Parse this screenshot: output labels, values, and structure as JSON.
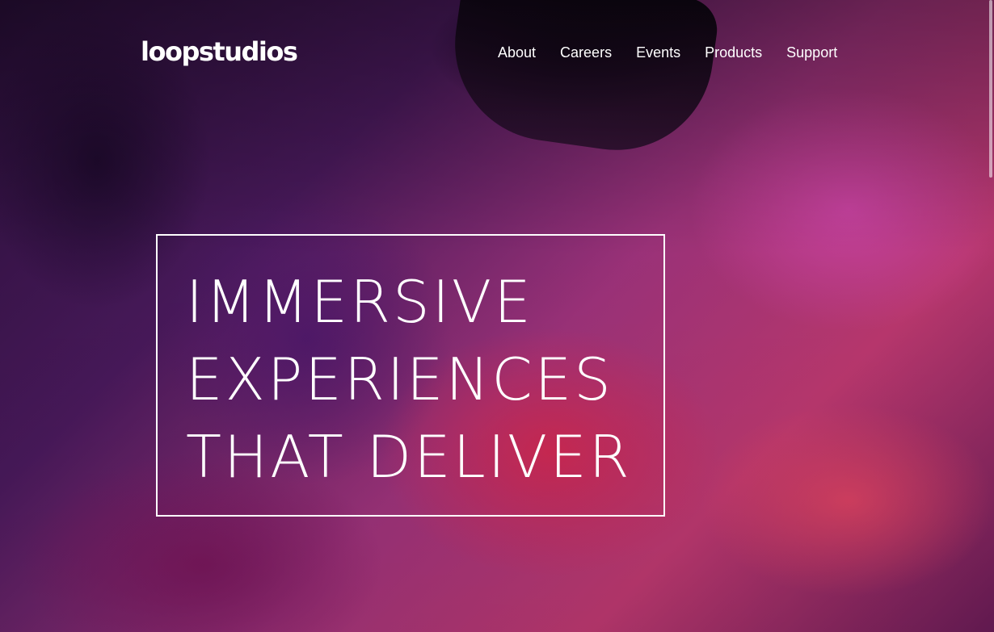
{
  "header": {
    "logo": "loopstudios",
    "nav": [
      {
        "label": "About"
      },
      {
        "label": "Careers"
      },
      {
        "label": "Events"
      },
      {
        "label": "Products"
      },
      {
        "label": "Support"
      }
    ]
  },
  "hero": {
    "headline_lines": [
      "IMMERSIVE",
      "EXPERIENCES",
      "THAT DELIVER"
    ],
    "background_image": "vr-headset-photo"
  },
  "colors": {
    "text": "#ffffff",
    "overlay_magenta": "#a2347e",
    "overlay_red": "#c23a73"
  }
}
